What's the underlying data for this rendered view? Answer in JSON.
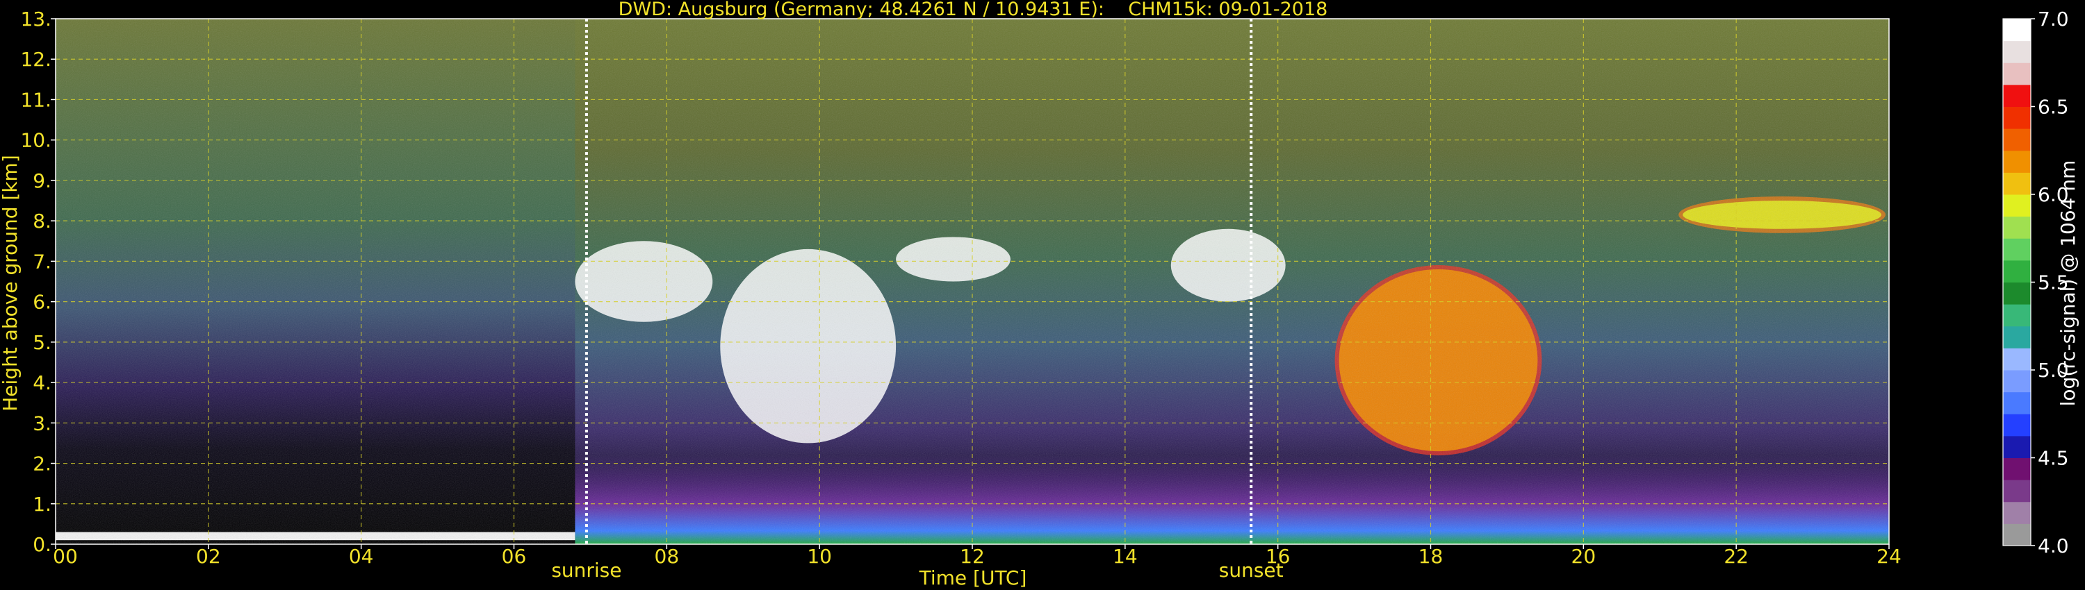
{
  "chart_data": {
    "type": "heatmap",
    "title": "DWD: Augsburg (Germany; 48.4261 N / 10.9431 E):    CHM15k: 09-01-2018",
    "xlabel": "Time [UTC]",
    "ylabel": "Height above ground [km]",
    "xlim": [
      0,
      24
    ],
    "ylim": [
      0,
      13
    ],
    "x_ticks": [
      {
        "v": 0,
        "label": "00"
      },
      {
        "v": 2,
        "label": "02"
      },
      {
        "v": 4,
        "label": "04"
      },
      {
        "v": 6,
        "label": "06"
      },
      {
        "v": 8,
        "label": "08"
      },
      {
        "v": 10,
        "label": "10"
      },
      {
        "v": 12,
        "label": "12"
      },
      {
        "v": 14,
        "label": "14"
      },
      {
        "v": 16,
        "label": "16"
      },
      {
        "v": 18,
        "label": "18"
      },
      {
        "v": 20,
        "label": "20"
      },
      {
        "v": 22,
        "label": "22"
      },
      {
        "v": 24,
        "label": "24"
      }
    ],
    "y_ticks": [
      {
        "v": 0,
        "label": "0."
      },
      {
        "v": 1,
        "label": "1."
      },
      {
        "v": 2,
        "label": "2."
      },
      {
        "v": 3,
        "label": "3."
      },
      {
        "v": 4,
        "label": "4."
      },
      {
        "v": 5,
        "label": "5."
      },
      {
        "v": 6,
        "label": "6."
      },
      {
        "v": 7,
        "label": "7."
      },
      {
        "v": 8,
        "label": "8."
      },
      {
        "v": 9,
        "label": "9."
      },
      {
        "v": 10,
        "label": "10."
      },
      {
        "v": 11,
        "label": "11."
      },
      {
        "v": 12,
        "label": "12."
      },
      {
        "v": 13,
        "label": "13."
      }
    ],
    "grid": true,
    "annotations": [
      {
        "label": "sunrise",
        "x": 6.95
      },
      {
        "label": "sunset",
        "x": 15.65
      }
    ],
    "colorbar": {
      "label": "log(rc-signal) @ 1064 nm",
      "range": [
        4.0,
        7.0
      ],
      "ticks": [
        {
          "v": 4.0,
          "label": "4.0"
        },
        {
          "v": 4.5,
          "label": "4.5"
        },
        {
          "v": 5.0,
          "label": "5.0"
        },
        {
          "v": 5.5,
          "label": "5.5"
        },
        {
          "v": 6.0,
          "label": "6.0"
        },
        {
          "v": 6.5,
          "label": "6.5"
        },
        {
          "v": 7.0,
          "label": "7.0"
        }
      ],
      "colors": [
        "#9a9a9a",
        "#a080a8",
        "#7a3a8a",
        "#701070",
        "#1a1ab0",
        "#2440ff",
        "#4a7aff",
        "#7a9cff",
        "#9ab8ff",
        "#2aa8a0",
        "#38b878",
        "#1c8a2c",
        "#30b040",
        "#60d060",
        "#a0e050",
        "#e0f020",
        "#f0c010",
        "#f09000",
        "#f06000",
        "#f03000",
        "#f01010",
        "#e8c0c0",
        "#e8e0e0",
        "#ffffff"
      ]
    },
    "features": [
      {
        "name": "surface-layer",
        "x": [
          0,
          6.8
        ],
        "y": [
          0.1,
          0.3
        ],
        "value": 7.0
      },
      {
        "name": "boundary-layer",
        "x": [
          6.8,
          24
        ],
        "y": [
          0,
          1.0
        ],
        "value": 4.7
      },
      {
        "name": "cloud-morning",
        "x": [
          6.8,
          8.6
        ],
        "y": [
          5.5,
          7.5
        ],
        "value": 7.0
      },
      {
        "name": "cloud-midday",
        "x": [
          8.7,
          11.0
        ],
        "y": [
          2.5,
          7.3
        ],
        "value": 7.0
      },
      {
        "name": "cloud-noon",
        "x": [
          11.0,
          12.5
        ],
        "y": [
          6.5,
          7.6
        ],
        "value": 7.0
      },
      {
        "name": "cloud-afternoon",
        "x": [
          14.6,
          16.1
        ],
        "y": [
          6.0,
          7.8
        ],
        "value": 7.0
      },
      {
        "name": "cloud-evening",
        "x": [
          16.8,
          19.4
        ],
        "y": [
          2.3,
          6.8
        ],
        "value": 6.2
      },
      {
        "name": "cirrus-night",
        "x": [
          21.3,
          23.9
        ],
        "y": [
          7.8,
          8.5
        ],
        "value": 5.9
      }
    ]
  }
}
